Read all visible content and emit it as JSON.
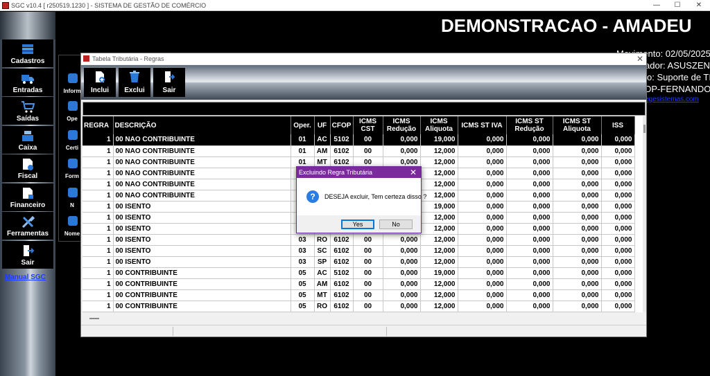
{
  "app": {
    "title": "SGC v10.4 [ r250519.1230 ] - SISTEMA DE GESTÃO DE COMÉRCIO",
    "win_min": "—",
    "win_max": "☐",
    "win_close": "✕"
  },
  "sidebar": {
    "items": [
      {
        "label": "Cadastros",
        "icon": "database-icon"
      },
      {
        "label": "Entradas",
        "icon": "truck-icon"
      },
      {
        "label": "Saídas",
        "icon": "cart-icon"
      },
      {
        "label": "Caixa",
        "icon": "cash-register-icon"
      },
      {
        "label": "Fiscal",
        "icon": "fiscal-document-icon"
      },
      {
        "label": "Financeiro",
        "icon": "finance-document-icon"
      },
      {
        "label": "Ferramentas",
        "icon": "tools-icon"
      },
      {
        "label": "Sair",
        "icon": "exit-door-icon"
      }
    ],
    "manual": "Manual SGC"
  },
  "header": {
    "company": "DEMONSTRACAO - AMADEU",
    "info_lines": [
      "Movimento: 02/05/2025",
      "ador: ASUSZEN",
      "o: Suporte de TI",
      "DP-FERNANDO",
      "egesistemas.com"
    ]
  },
  "bg_panel": {
    "items": [
      "Inform",
      "Ope",
      "Certi",
      "Form",
      "N",
      "Nome"
    ]
  },
  "tabela": {
    "title": "Tabela Tributária - Regras",
    "close": "✕",
    "toolbar": {
      "inclui": "Inclui",
      "exclui": "Exclui",
      "sair": "Sair"
    },
    "columns": [
      "REGRA",
      "DESCRIÇÃO",
      "Oper.",
      "UF",
      "CFOP",
      "ICMS CST",
      "ICMS Redução",
      "ICMS Aliquota",
      "ICMS ST IVA",
      "ICMS ST Redução",
      "ICMS ST Aliquota",
      "ISS"
    ],
    "rows": [
      [
        "1",
        "00 NAO CONTRIBUINTE",
        "01",
        "AC",
        "5102",
        "00",
        "0,000",
        "19,000",
        "0,000",
        "0,000",
        "0,000",
        "0,000"
      ],
      [
        "1",
        "00 NAO CONTRIBUINTE",
        "01",
        "AM",
        "6102",
        "00",
        "0,000",
        "12,000",
        "0,000",
        "0,000",
        "0,000",
        "0,000"
      ],
      [
        "1",
        "00 NAO CONTRIBUINTE",
        "01",
        "MT",
        "6102",
        "00",
        "0,000",
        "12,000",
        "0,000",
        "0,000",
        "0,000",
        "0,000"
      ],
      [
        "1",
        "00 NAO CONTRIBUINTE",
        "",
        "",
        "",
        "",
        "",
        "12,000",
        "0,000",
        "0,000",
        "0,000",
        "0,000"
      ],
      [
        "1",
        "00 NAO CONTRIBUINTE",
        "",
        "",
        "",
        "",
        "",
        "12,000",
        "0,000",
        "0,000",
        "0,000",
        "0,000"
      ],
      [
        "1",
        "00 NAO CONTRIBUINTE",
        "",
        "",
        "",
        "",
        "",
        "12,000",
        "0,000",
        "0,000",
        "0,000",
        "0,000"
      ],
      [
        "1",
        "00 ISENTO",
        "",
        "",
        "",
        "",
        "",
        "19,000",
        "0,000",
        "0,000",
        "0,000",
        "0,000"
      ],
      [
        "1",
        "00 ISENTO",
        "",
        "",
        "",
        "",
        "",
        "12,000",
        "0,000",
        "0,000",
        "0,000",
        "0,000"
      ],
      [
        "1",
        "00 ISENTO",
        "",
        "",
        "",
        "",
        "",
        "12,000",
        "0,000",
        "0,000",
        "0,000",
        "0,000"
      ],
      [
        "1",
        "00 ISENTO",
        "03",
        "RO",
        "6102",
        "00",
        "0,000",
        "12,000",
        "0,000",
        "0,000",
        "0,000",
        "0,000"
      ],
      [
        "1",
        "00 ISENTO",
        "03",
        "SC",
        "6102",
        "00",
        "0,000",
        "12,000",
        "0,000",
        "0,000",
        "0,000",
        "0,000"
      ],
      [
        "1",
        "00 ISENTO",
        "03",
        "SP",
        "6102",
        "00",
        "0,000",
        "12,000",
        "0,000",
        "0,000",
        "0,000",
        "0,000"
      ],
      [
        "1",
        "00 CONTRIBUINTE",
        "05",
        "AC",
        "5102",
        "00",
        "0,000",
        "19,000",
        "0,000",
        "0,000",
        "0,000",
        "0,000"
      ],
      [
        "1",
        "00 CONTRIBUINTE",
        "05",
        "AM",
        "6102",
        "00",
        "0,000",
        "12,000",
        "0,000",
        "0,000",
        "0,000",
        "0,000"
      ],
      [
        "1",
        "00 CONTRIBUINTE",
        "05",
        "MT",
        "6102",
        "00",
        "0,000",
        "12,000",
        "0,000",
        "0,000",
        "0,000",
        "0,000"
      ],
      [
        "1",
        "00 CONTRIBUINTE",
        "05",
        "RO",
        "6102",
        "00",
        "0,000",
        "12,000",
        "0,000",
        "0,000",
        "0,000",
        "0,000"
      ]
    ]
  },
  "dialog": {
    "title": "Excluindo Regra Tributária",
    "close": "✕",
    "icon": "?",
    "message": "DESEJA excluir, Tem certeza disso ?",
    "yes": "Yes",
    "no": "No"
  },
  "colors": {
    "dialog_title": "#7b2a9e",
    "link": "#1a3cff",
    "question_icon": "#2a7de0"
  }
}
